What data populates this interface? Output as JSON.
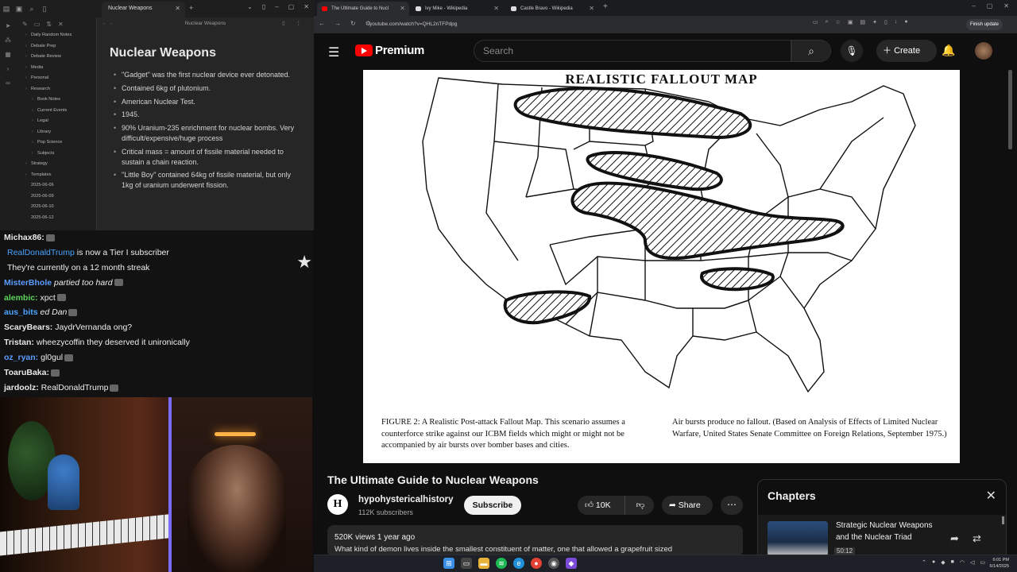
{
  "obsidian": {
    "tab_title": "Nuclear Weapons",
    "note_header": "Nuclear Weapons",
    "note_title": "Nuclear Weapons",
    "tree": [
      {
        "label": "Daily Random Notes",
        "indent": 1
      },
      {
        "label": "Debate Prep",
        "indent": 1
      },
      {
        "label": "Debate Review",
        "indent": 1
      },
      {
        "label": "Media",
        "indent": 1
      },
      {
        "label": "Personal",
        "indent": 1
      },
      {
        "label": "Research",
        "indent": 1
      },
      {
        "label": "Book Notes",
        "indent": 2
      },
      {
        "label": "Current Events",
        "indent": 2
      },
      {
        "label": "Legal",
        "indent": 2
      },
      {
        "label": "Library",
        "indent": 2
      },
      {
        "label": "Pop Science",
        "indent": 2
      },
      {
        "label": "Subjects",
        "indent": 2
      },
      {
        "label": "Strategy",
        "indent": 1
      },
      {
        "label": "Templates",
        "indent": 1
      },
      {
        "label": "2025-06-06",
        "indent": 1
      },
      {
        "label": "2025-06-09",
        "indent": 1
      },
      {
        "label": "2025-06-10",
        "indent": 1
      },
      {
        "label": "2025-06-12",
        "indent": 1
      }
    ],
    "bullets": [
      "\"Gadget\" was the first nuclear device ever detonated.",
      "Contained 6kg of plutonium.",
      "American Nuclear Test.",
      "1945.",
      "90% Uranium-235 enrichment for nuclear bombs. Very difficult/expensive/huge process",
      "Critical mass = amount of fissile material needed to sustain a chain reaction.",
      "\"Little Boy\" contained 64kg of fissile material, but only 1kg of uranium underwent fission."
    ]
  },
  "chat": {
    "messages": [
      {
        "user": "Michax86:",
        "text": "",
        "color": "#e8e8e8"
      },
      {
        "user": "RealDonaldTrump",
        "text": " is now a Tier I subscriber",
        "color": "#4aa3ff",
        "system": true
      },
      {
        "user": "",
        "text": "They're currently on a 12 month streak",
        "color": "#eee",
        "system": true
      },
      {
        "user": "MisterBhole",
        "text": " partied too hard",
        "color": "#5b9cff",
        "italic": true
      },
      {
        "user": "alembic:",
        "text": " xpct",
        "color": "#5bd35b"
      },
      {
        "user": "aus_bits",
        "text": " ed Dan",
        "color": "#4aa3ff",
        "italic": true
      },
      {
        "user": "ScaryBears:",
        "text": " JaydrVernanda  ong?",
        "color": "#e8e8e8"
      },
      {
        "user": "Tristan:",
        "text": " wheezycoffin they deserved it unironically",
        "color": "#e8e8e8"
      },
      {
        "user": "oz_ryan:",
        "text": " gl0gul",
        "color": "#5b9cff"
      },
      {
        "user": "ToaruBaka:",
        "text": "",
        "color": "#e8e8e8"
      },
      {
        "user": "jardoolz:",
        "text": " RealDonaldTrump",
        "color": "#e8e8e8"
      }
    ]
  },
  "browser": {
    "tabs": [
      {
        "label": "The Ultimate Guide to Nucl",
        "fav": "#ff0000",
        "active": true
      },
      {
        "label": "Ivy Mike - Wikipedia",
        "fav": "#dddddd",
        "active": false
      },
      {
        "label": "Castle Bravo - Wikipedia",
        "fav": "#dddddd",
        "active": false
      }
    ],
    "url": "youtube.com/watch?v=QHL2nTFPdpg",
    "finish_update": "Finish update"
  },
  "youtube": {
    "logo_text": "Premium",
    "search_placeholder": "Search",
    "create_label": "Create",
    "video": {
      "figure_title": "REALISTIC FALLOUT MAP",
      "caption_left": "FIGURE 2: A Realistic Post-attack Fallout Map. This scenario assumes a counterforce strike against our ICBM fields which might or might not be accompanied by air bursts over bomber bases and cities.",
      "caption_right": "Air bursts produce no fallout. (Based on Analysis of Effects of Limited Nuclear Warfare, United States Senate Committee on Foreign Relations, September 1975.)"
    },
    "title": "The Ultimate Guide to Nuclear Weapons",
    "channel": {
      "avatar_letter": "H",
      "name": "hypohystericalhistory",
      "subscribers": "112K subscribers"
    },
    "subscribe_label": "Subscribe",
    "likes": "10K",
    "share_label": "Share",
    "description": {
      "stats": "520K views  1 year ago",
      "text": "What kind of demon lives inside the smallest constituent of matter, one that allowed a grapefruit sized"
    },
    "chapters": {
      "title": "Chapters",
      "item_label": "Strategic Nuclear Weapons and the Nuclear Triad",
      "item_time": "50:12"
    }
  },
  "taskbar": {
    "clock_time": "6:01 PM",
    "clock_date": "6/14/2025"
  }
}
